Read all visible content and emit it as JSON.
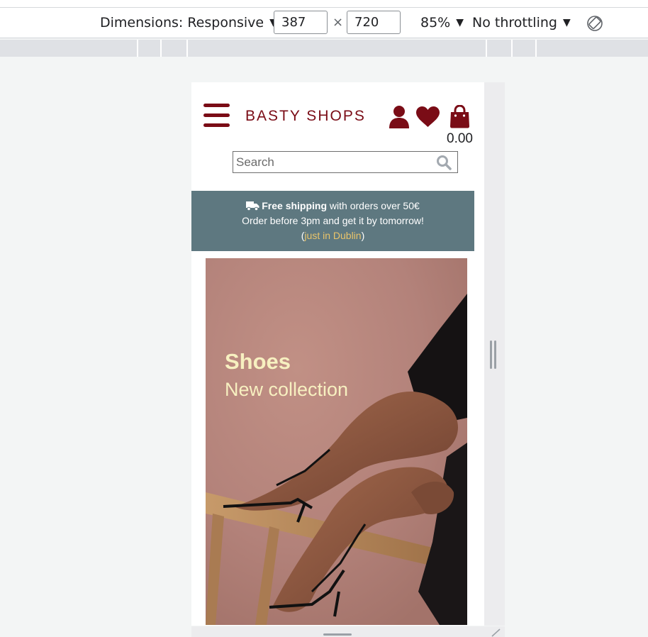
{
  "devtools": {
    "dimensions_label": "Dimensions: Responsive",
    "width": "387",
    "times": "×",
    "height": "720",
    "zoom": "85%",
    "throttling": "No throttling",
    "rotate_icon": "rotate-device-icon"
  },
  "site": {
    "brand": "BASTY SHOPS",
    "cart_total": "0.00",
    "icons": [
      "menu-icon",
      "user-icon",
      "heart-icon",
      "shopping-bag-icon",
      "search-icon"
    ],
    "search": {
      "placeholder": "Search"
    },
    "banner": {
      "shipping_bold": "Free shipping",
      "shipping_rest": " with orders over 50€",
      "line2": "Order before 3pm and get it by tomorrow!",
      "paren_open": "(",
      "link_text": "just in Dublin",
      "paren_close": ")"
    },
    "hero": {
      "title": "Shoes",
      "subtitle": "New collection"
    }
  },
  "colors": {
    "brand": "#7a0c16",
    "banner_bg": "#5e7880",
    "banner_link": "#e9c46a",
    "hero_text": "#f7f0c0"
  }
}
